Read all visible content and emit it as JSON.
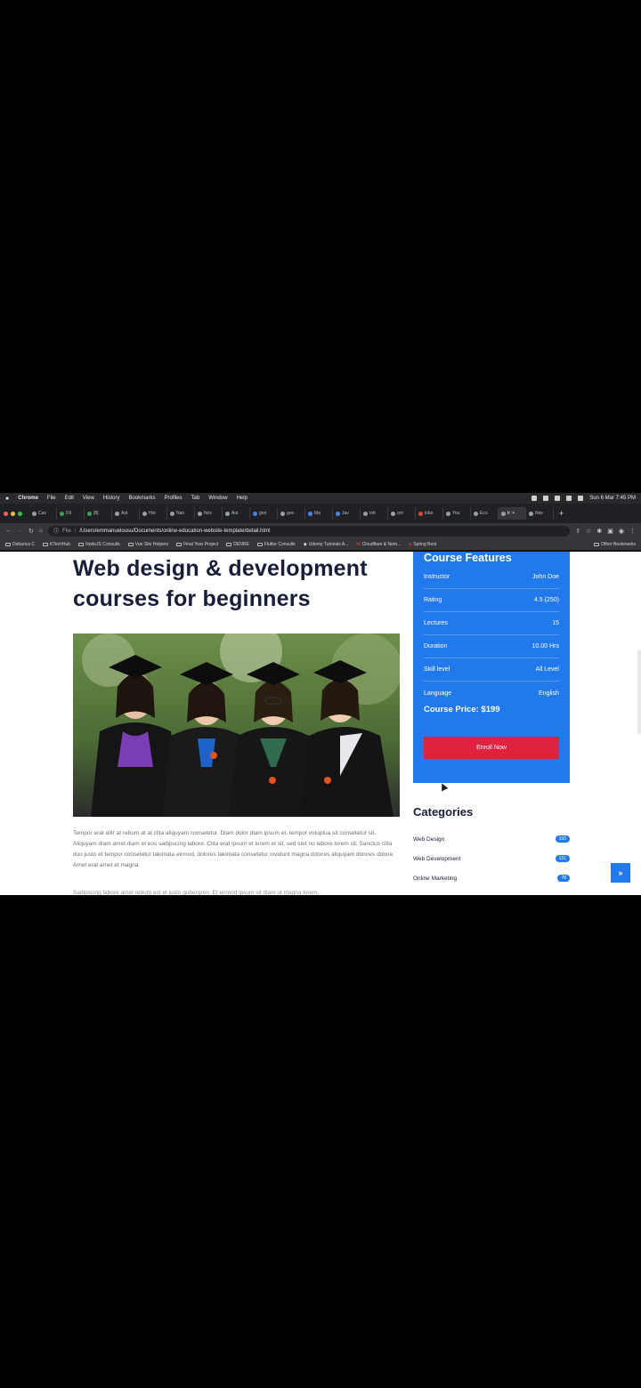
{
  "menubar": {
    "app": "Chrome",
    "items": [
      "File",
      "Edit",
      "View",
      "History",
      "Bookmarks",
      "Profiles",
      "Tab",
      "Window",
      "Help"
    ],
    "datetime": "Sun 6 Mar 7:45 PM"
  },
  "tabs": [
    "Cas",
    "Dil",
    "[8]",
    "Aut",
    "Hor",
    "Nan",
    "Nov",
    "Aut",
    "goo",
    "goo",
    "Ma",
    "Jav",
    "Intr",
    "onl",
    "inbo",
    "You",
    "Eco",
    "Ir",
    "Nav"
  ],
  "address": {
    "scheme": "File",
    "url": "/Users/emmanuelousu/Documents/online-education-website-template/detail.html"
  },
  "bookmarks": [
    "Debanca C",
    "KTechHub",
    "NodeJS Consults",
    "Vue Site Helpers",
    "Final Year Project",
    "DENRE",
    "Flutter Consults",
    "Udemy Tutorials A...",
    "Cloudflare & Nem...",
    "Spring Boot"
  ],
  "bookmarks_other": "Other Bookmarks",
  "page": {
    "title": "Web design & development courses for beginners",
    "paragraph": "Tempor erat elitr at rebum at at clita aliquyam consetetur. Diam dolor diam ipsum et, tempor voluptua sit consetetur sit. Aliquyam diam amet diam et eos sadipscing labore. Clita erat ipsum et lorem et sit, sed stet no labore lorem sit. Sanctus clita duo justo et tempor consetetur takimata eirmod, dolores takimata consetetur invidunt magna dolores aliquyam dolores dolore. Amet erat amet et magna",
    "paragraph2": "Sadipscing labore amet rebum est et justo gubergren. Et eirmod ipsum sit diam ut magna lorem."
  },
  "features": {
    "title": "Course Features",
    "rows": [
      {
        "label": "Instructor",
        "value": "John Doe"
      },
      {
        "label": "Rating",
        "value": "4.5 (250)"
      },
      {
        "label": "Lectures",
        "value": "15"
      },
      {
        "label": "Duration",
        "value": "10.00 Hrs"
      },
      {
        "label": "Skill level",
        "value": "All Level"
      },
      {
        "label": "Language",
        "value": "English"
      }
    ],
    "price": "Course Price: $199",
    "enroll": "Enroll Now"
  },
  "categories": {
    "title": "Categories",
    "items": [
      {
        "label": "Web Design",
        "count": "150"
      },
      {
        "label": "Web Development",
        "count": "131"
      },
      {
        "label": "Online Marketing",
        "count": "78"
      }
    ]
  },
  "back_to_top": "»",
  "colors": {
    "primary": "#2179ec",
    "enroll": "#e0213f",
    "heading": "#181d38"
  }
}
